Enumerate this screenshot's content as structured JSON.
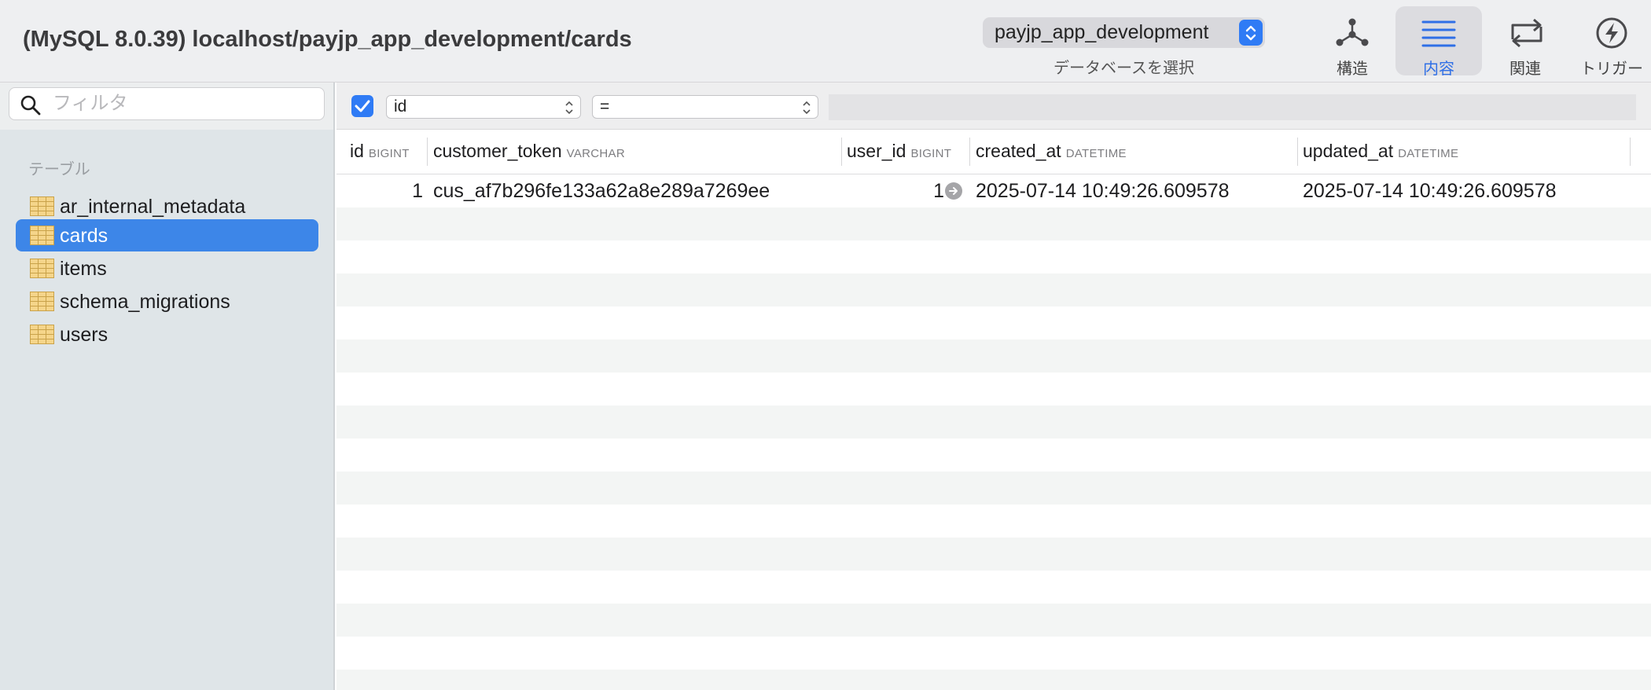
{
  "window": {
    "title": "(MySQL 8.0.39) localhost/payjp_app_development/cards"
  },
  "database_selector": {
    "value": "payjp_app_development",
    "caption": "データベースを選択"
  },
  "toolbar": {
    "structure_label": "構造",
    "content_label": "内容",
    "relations_label": "関連",
    "triggers_label": "トリガー"
  },
  "sidebar": {
    "filter_placeholder": "フィルタ",
    "section_label": "テーブル",
    "items": [
      {
        "label": "ar_internal_metadata"
      },
      {
        "label": "cards"
      },
      {
        "label": "items"
      },
      {
        "label": "schema_migrations"
      },
      {
        "label": "users"
      }
    ],
    "selected_index": 1
  },
  "filter_bar": {
    "enabled": true,
    "field": "id",
    "operator": "=",
    "value": ""
  },
  "grid": {
    "columns": [
      {
        "name": "id",
        "type": "BIGINT"
      },
      {
        "name": "customer_token",
        "type": "VARCHAR"
      },
      {
        "name": "user_id",
        "type": "BIGINT"
      },
      {
        "name": "created_at",
        "type": "DATETIME"
      },
      {
        "name": "updated_at",
        "type": "DATETIME"
      }
    ],
    "rows": [
      {
        "id": "1",
        "customer_token": "cus_af7b296fe133a62a8e289a7269ee",
        "user_id": "1",
        "created_at": "2025-07-14 10:49:26.609578",
        "updated_at": "2025-07-14 10:49:26.609578"
      }
    ]
  },
  "colors": {
    "accent": "#2f7bf5",
    "selection": "#3d86e8",
    "sidebar_bg": "#dfe5e8",
    "alt_row": "#f3f5f4"
  },
  "icons": {
    "structure": "structure-graph-icon",
    "content": "list-lines-icon",
    "relations": "relations-arrows-icon",
    "triggers": "lightning-bolt-icon",
    "search": "magnifier-icon",
    "table": "table-grid-icon",
    "foreign_key": "arrow-circle-icon"
  }
}
